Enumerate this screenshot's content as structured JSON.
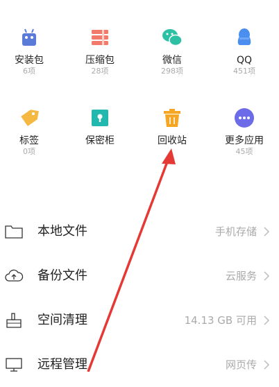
{
  "grid": [
    {
      "label": "安装包",
      "count": "6项",
      "icon": "android-icon",
      "color": "#5a7bd8"
    },
    {
      "label": "压缩包",
      "count": "28项",
      "icon": "zip-icon",
      "color": "#f17a6b"
    },
    {
      "label": "微信",
      "count": "298项",
      "icon": "wechat-icon",
      "color": "#2cc0a4"
    },
    {
      "label": "QQ",
      "count": "451项",
      "icon": "qq-icon",
      "color": "#4a8ff0"
    },
    {
      "label": "标签",
      "count": "0项",
      "icon": "tag-icon",
      "color": "#f5b942"
    },
    {
      "label": "保密柜",
      "count": "",
      "icon": "safe-icon",
      "color": "#22b8b0"
    },
    {
      "label": "回收站",
      "count": "",
      "icon": "trash-icon",
      "color": "#f5a623"
    },
    {
      "label": "更多应用",
      "count": "45项",
      "icon": "more-icon",
      "color": "#6c6ce8"
    }
  ],
  "list": [
    {
      "title": "本地文件",
      "sub": "手机存储",
      "icon": "folder-icon"
    },
    {
      "title": "备份文件",
      "sub": "云服务",
      "icon": "cloud-upload-icon"
    },
    {
      "title": "空间清理",
      "sub": "14.13 GB 可用",
      "icon": "broom-icon"
    },
    {
      "title": "远程管理",
      "sub": "网页传",
      "icon": "monitor-icon"
    }
  ],
  "annotation_color": "#e53935"
}
